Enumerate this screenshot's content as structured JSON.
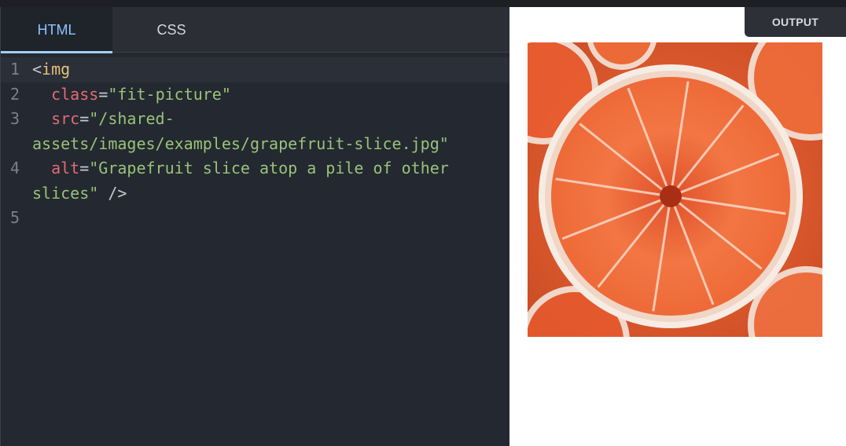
{
  "editor": {
    "tabs": [
      {
        "label": "HTML",
        "active": true
      },
      {
        "label": "CSS",
        "active": false
      }
    ],
    "line_numbers": [
      "1",
      "2",
      "3",
      "4",
      "5"
    ],
    "code": {
      "l1_open": "<",
      "l1_tag": "img",
      "l2_attr": "class",
      "l2_eq": "=",
      "l2_val": "\"fit-picture\"",
      "l3_attr": "src",
      "l3_eq": "=",
      "l3_val": "\"/shared-assets/images/examples/grapefruit-slice.jpg\"",
      "l4_attr": "alt",
      "l4_eq": "=",
      "l4_val": "\"Grapefruit slice atop a pile of other slices\"",
      "l4_close": " />"
    }
  },
  "output": {
    "button_label": "OUTPUT",
    "image_alt": "Grapefruit slice atop a pile of other slices"
  },
  "colors": {
    "editor_bg": "#242830",
    "tab_active_text": "#8fc4ff",
    "tag": "#e5c07b",
    "attr": "#e06c75",
    "string": "#98c379",
    "grapefruit": "#ef6a3c"
  }
}
